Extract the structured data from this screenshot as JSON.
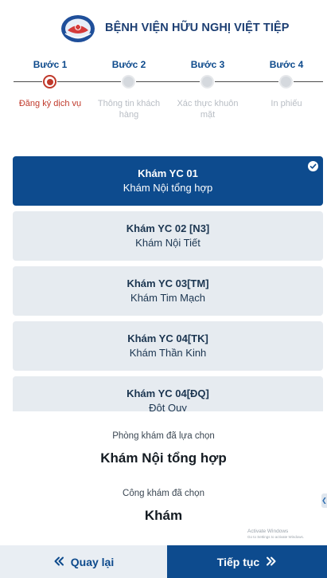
{
  "header": {
    "hospital_name": "BỆNH VIỆN HỮU NGHỊ VIỆT TIỆP",
    "logo_icon": "hospital-logo-icon"
  },
  "steps": [
    {
      "title": "Bước 1",
      "label": "Đăng ký dịch vụ",
      "state": "active"
    },
    {
      "title": "Bước 2",
      "label": "Thông tin khách hàng",
      "state": "inactive"
    },
    {
      "title": "Bước 3",
      "label": "Xác thực khuôn mặt",
      "state": "inactive"
    },
    {
      "title": "Bước 4",
      "label": "In phiếu",
      "state": "inactive"
    }
  ],
  "services": [
    {
      "code": "Khám YC 01",
      "name": "Khám Nội tổng hợp",
      "selected": true
    },
    {
      "code": "Khám YC 02 [N3]",
      "name": "Khám Nội Tiết",
      "selected": false
    },
    {
      "code": "Khám YC 03[TM]",
      "name": "Khám Tim Mạch",
      "selected": false
    },
    {
      "code": "Khám YC 04[TK]",
      "name": "Khám Thần Kinh",
      "selected": false
    },
    {
      "code": "Khám YC 04[ĐQ]",
      "name": "Đột Quỵ",
      "selected": false
    }
  ],
  "summary": {
    "clinic_label": "Phòng khám đã lựa chọn",
    "clinic_value": "Khám Nội tổng hợp",
    "service_label": "Công khám đã chọn",
    "service_value": "Khám"
  },
  "watermark": {
    "title": "Activate Windows",
    "subtitle": "Go to Settings to activate Windows."
  },
  "footer": {
    "back_label": "Quay lại",
    "next_label": "Tiếp tục"
  },
  "colors": {
    "primary": "#0d4b8e",
    "active_step": "#c0392b",
    "card_bg": "#e6ebf0"
  }
}
